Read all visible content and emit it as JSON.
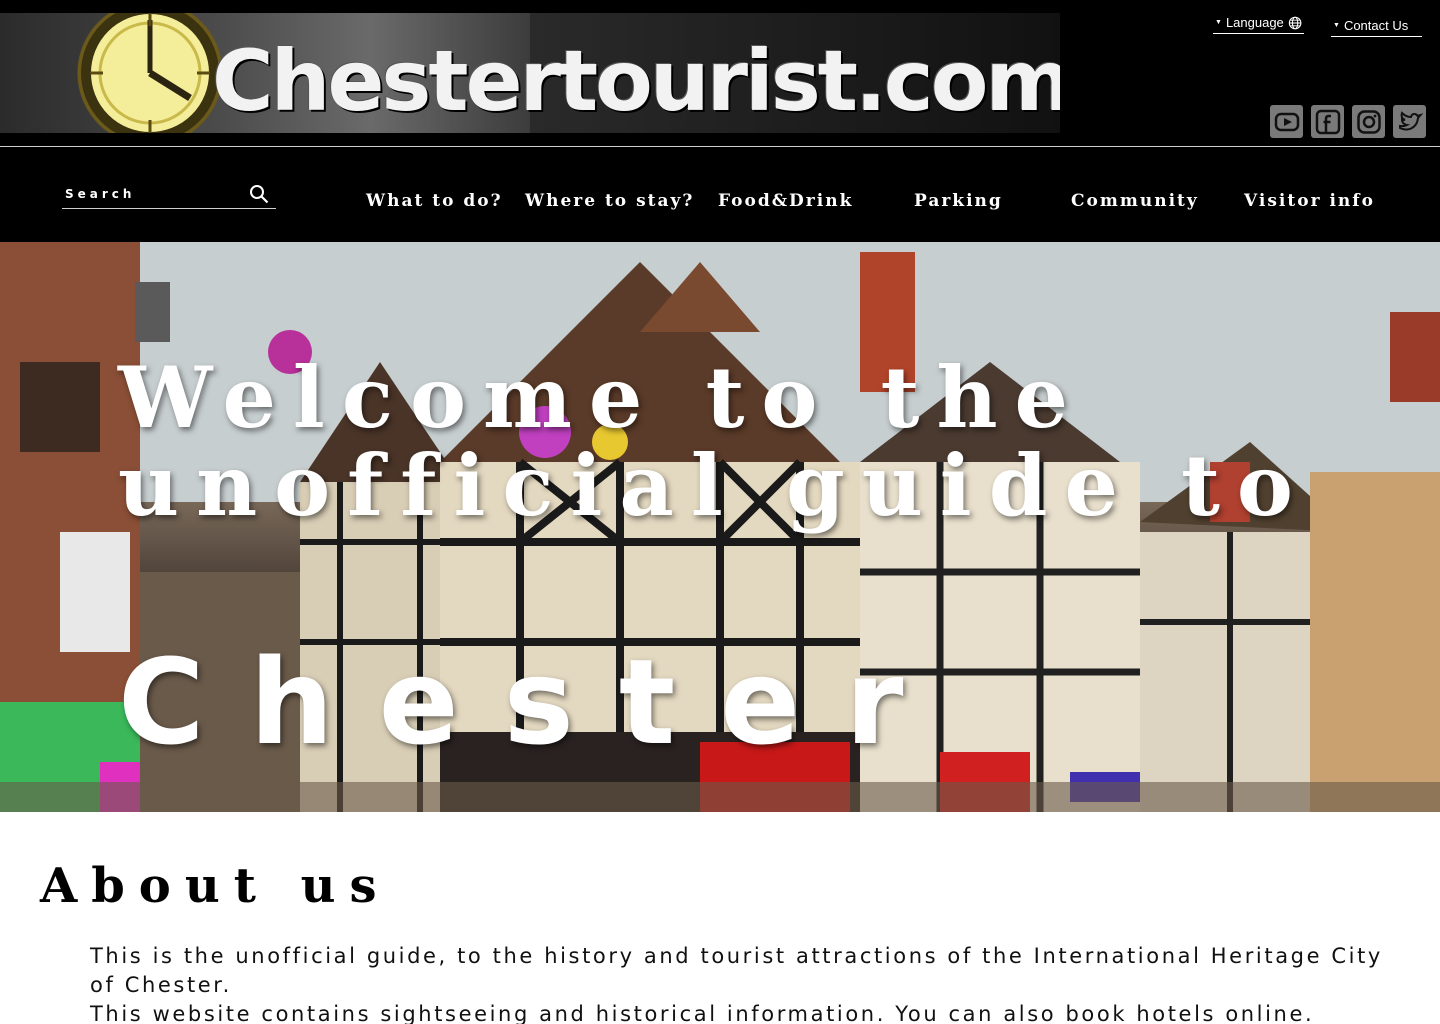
{
  "header": {
    "logo_text": "Chestertourist.com",
    "language_label": "Language",
    "contact_label": "Contact Us",
    "social": [
      {
        "icon": "youtube-icon"
      },
      {
        "icon": "facebook-icon"
      },
      {
        "icon": "instagram-icon"
      },
      {
        "icon": "twitter-icon"
      }
    ]
  },
  "nav": {
    "search_placeholder": "Search",
    "items": [
      {
        "label": "What to do?"
      },
      {
        "label": "Where to stay?"
      },
      {
        "label": "Food&Drink"
      },
      {
        "label": "Parking"
      },
      {
        "label": "Community"
      },
      {
        "label": "Visitor info"
      }
    ]
  },
  "hero": {
    "title_line1": "Welcome to the",
    "title_line2": "unofficial guide to",
    "title_city": "Chester"
  },
  "about": {
    "heading": "About us",
    "paragraph_1": "This is the unofficial guide, to the history and tourist attractions of the International Heritage City of Chester.",
    "paragraph_2": "This website contains sightseeing and historical information. You can also book hotels online."
  },
  "colors": {
    "header_bg": "#000000",
    "text_light": "#ffffff",
    "social_icon_bg": "#7a7a7a"
  }
}
